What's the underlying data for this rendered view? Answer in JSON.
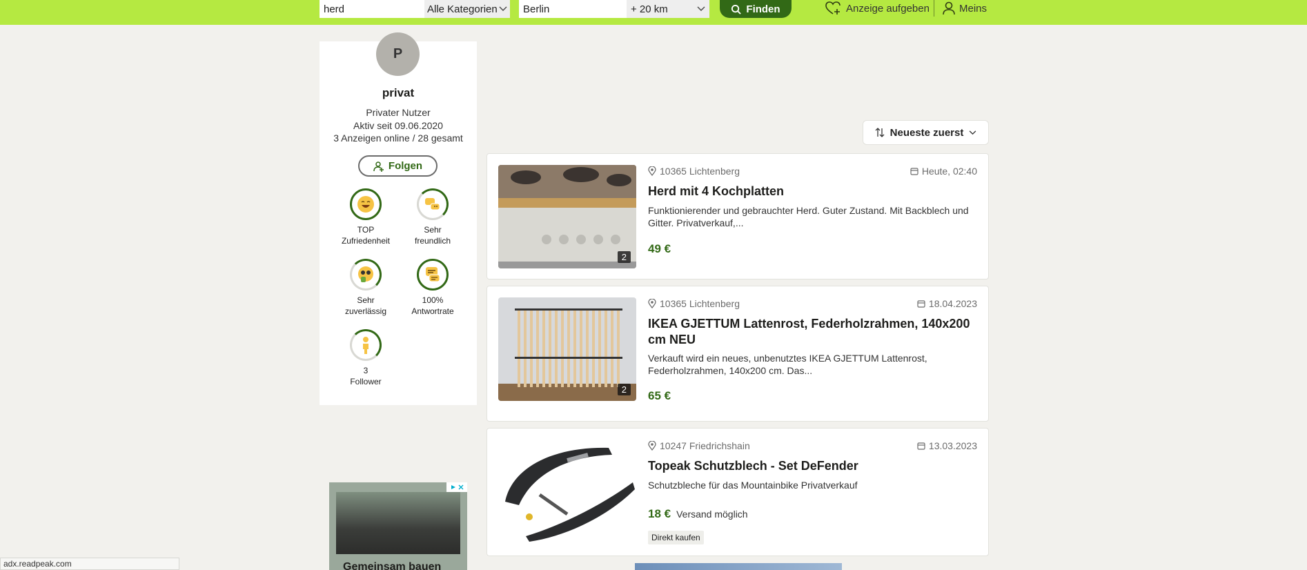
{
  "header": {
    "search_value": "herd",
    "category": "Alle Kategorien",
    "location_value": "Berlin",
    "radius": "+ 20 km",
    "find_label": "Finden",
    "post_ad_label": "Anzeige aufgeben",
    "account_label": "Meins",
    "colors": {
      "bar": "#b5e941",
      "button": "#326916"
    }
  },
  "profile": {
    "avatar_letter": "P",
    "name": "privat",
    "type": "Privater Nutzer",
    "active_since": "Aktiv seit 09.06.2020",
    "ads_count": "3 Anzeigen online / 28 gesamt",
    "follow_label": "Folgen",
    "badges": [
      {
        "icon": "laughing-face-icon",
        "line1": "TOP",
        "line2": "Zufriedenheit"
      },
      {
        "icon": "chat-bubbles-icon",
        "line1": "Sehr",
        "line2": "freundlich"
      },
      {
        "icon": "thumbs-up-face-icon",
        "line1": "Sehr",
        "line2": "zuverlässig"
      },
      {
        "icon": "message-lines-icon",
        "line1": "100%",
        "line2": "Antwortrate"
      },
      {
        "icon": "person-icon",
        "line1": "3",
        "line2": "Follower"
      }
    ]
  },
  "ad": {
    "headline": "Gemeinsam bauen"
  },
  "sort": {
    "label": "Neueste zuerst"
  },
  "listings": [
    {
      "location": "10365 Lichtenberg",
      "date": "Heute, 02:40",
      "title": "Herd mit 4 Kochplatten",
      "description": "Funktionierender und gebrauchter Herd. Guter Zustand. Mit Backblech und Gitter. Privatverkauf,...",
      "price": "49 €",
      "image_count": "2"
    },
    {
      "location": "10365 Lichtenberg",
      "date": "18.04.2023",
      "title": "IKEA GJETTUM Lattenrost, Federholzrahmen, 140x200 cm NEU",
      "description": "Verkauft wird ein neues, unbenutztes IKEA GJETTUM Lattenrost, Federholzrahmen, 140x200 cm. Das...",
      "price": "65 €",
      "image_count": "2"
    },
    {
      "location": "10247 Friedrichshain",
      "date": "13.03.2023",
      "title": "Topeak Schutzblech - Set DeFender",
      "description": "Schutzbleche für das Mountainbike Privatverkauf",
      "price": "18 €",
      "shipping": "Versand möglich",
      "tag": "Direkt kaufen"
    }
  ],
  "status_url": "adx.readpeak.com"
}
